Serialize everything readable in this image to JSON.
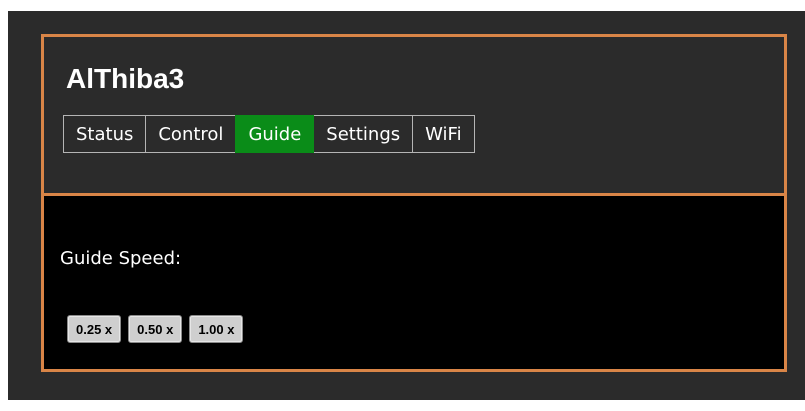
{
  "header": {
    "title": "AlThiba3"
  },
  "tabs": [
    {
      "label": "Status",
      "active": false
    },
    {
      "label": "Control",
      "active": false
    },
    {
      "label": "Guide",
      "active": true
    },
    {
      "label": "Settings",
      "active": false
    },
    {
      "label": "WiFi",
      "active": false
    }
  ],
  "guide": {
    "speed_label": "Guide Speed:",
    "speed_buttons": [
      "0.25 x",
      "0.50 x",
      "1.00 x"
    ]
  },
  "colors": {
    "frame_border": "#d98547",
    "active_tab": "#0a8c18",
    "header_background": "#2b2b2b",
    "panel_background": "#000000"
  }
}
